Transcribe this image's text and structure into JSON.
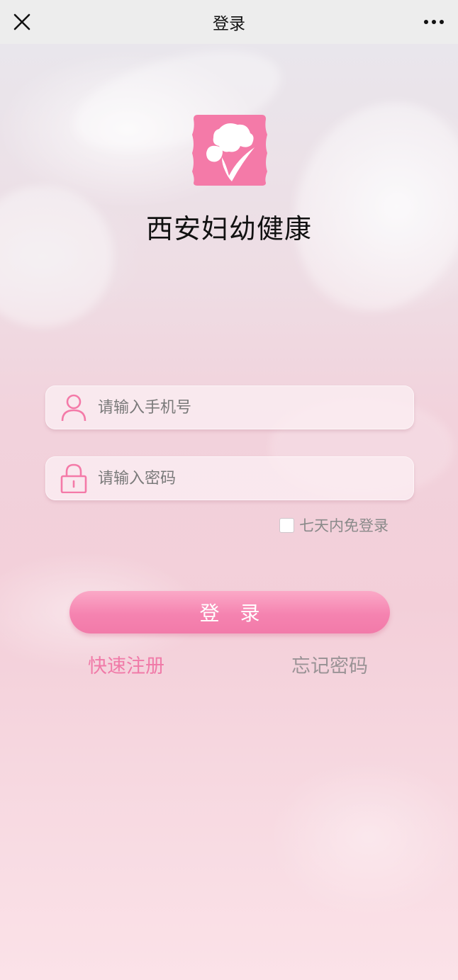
{
  "topbar": {
    "title": "登录",
    "close_icon": "close-icon",
    "more_icon": "more-dots-icon"
  },
  "app": {
    "name": "西安妇幼健康",
    "logo_icon": "app-logo-icon",
    "brand_color": "#f47aa8"
  },
  "form": {
    "phone": {
      "placeholder": "请输入手机号",
      "value": "",
      "icon": "user-icon"
    },
    "password": {
      "placeholder": "请输入密码",
      "value": "",
      "icon": "lock-icon"
    },
    "remember": {
      "label": "七天内免登录",
      "checked": false
    },
    "login_label": "登 录"
  },
  "links": {
    "register": "快速注册",
    "forgot": "忘记密码"
  }
}
